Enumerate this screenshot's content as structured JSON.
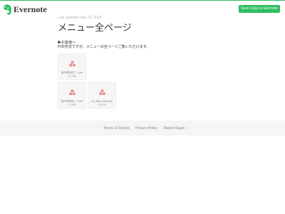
{
  "header": {
    "logo_text": "Evernote",
    "save_button_label": "Save Copy to Evernote"
  },
  "note": {
    "last_updated": "Last updated: Sep 10, 2015",
    "title": "メニュー全ページ",
    "intro_line1": "▶お客様へ",
    "intro_line2": "PDF形式ですが、メニューの全ページご覧いただけます。"
  },
  "attachments": [
    {
      "icon": "pdf-icon",
      "name": "裕子草本初ごー.pdf",
      "size": "3.4 MB"
    },
    {
      "icon": "pdf-icon",
      "name": "裕子草本初ごー.pdf",
      "size": "3.7 MB"
    },
    {
      "icon": "pdf-icon",
      "name": "cc_drink_menu.pdf",
      "size": "413 KB"
    }
  ],
  "footer": {
    "links": [
      "Terms of Service",
      "Privacy Policy",
      "Report Spam"
    ]
  },
  "colors": {
    "brand_green": "#2dbe60",
    "pdf_red": "#d9534f",
    "footer_bg": "#f5f5f5"
  }
}
